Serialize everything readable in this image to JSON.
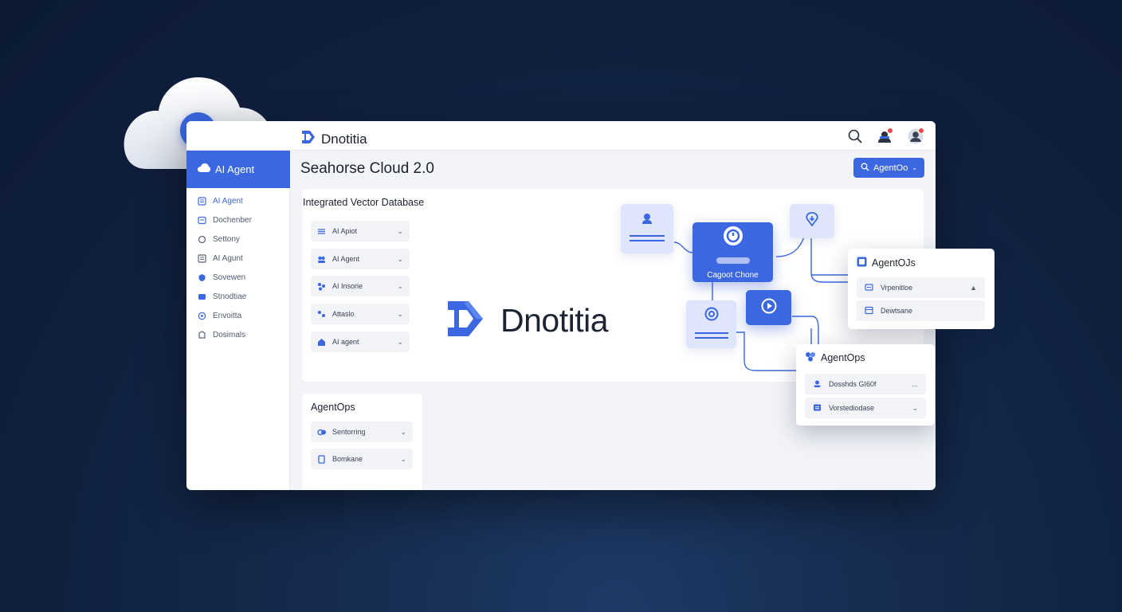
{
  "colors": {
    "accent": "#3b68e0",
    "background": "#0f1f3d",
    "badge": "#e5484d"
  },
  "header": {
    "brand": "Dnotitia",
    "icons": [
      "search-icon",
      "notifications-icon",
      "user-avatar-icon"
    ]
  },
  "sidebar": {
    "head_label": "AI Agent",
    "items": [
      {
        "label": "AI Agent",
        "icon": "agent-icon"
      },
      {
        "label": "Dochenber",
        "icon": "document-icon"
      },
      {
        "label": "Settony",
        "icon": "settings-icon"
      },
      {
        "label": "AI Agunt",
        "icon": "list-icon"
      },
      {
        "label": "Sovewen",
        "icon": "shield-icon"
      },
      {
        "label": "Stnodtiae",
        "icon": "structure-icon"
      },
      {
        "label": "Envoitta",
        "icon": "compass-icon"
      },
      {
        "label": "Dosimals",
        "icon": "database-icon"
      }
    ]
  },
  "main": {
    "title": "Seahorse Cloud 2.0",
    "agent_button": "AgentOo",
    "panel": {
      "title": "Integrated Vector Database",
      "dropdowns": [
        {
          "label": "AI Apiot"
        },
        {
          "label": "AI Agent"
        },
        {
          "label": "AI Insorie"
        },
        {
          "label": "Attaslo"
        },
        {
          "label": "AI agent"
        }
      ],
      "logo_text": "Dnotitia",
      "diagram": {
        "center_node_label": "Cagoot Chone"
      }
    },
    "agentops_panel": {
      "title": "AgentOps",
      "dropdowns": [
        {
          "label": "Sentorring"
        },
        {
          "label": "Bomkane"
        }
      ]
    }
  },
  "floating_cards": {
    "card1": {
      "title": "AgentOJs",
      "rows": [
        {
          "label": "Vrpenitloe"
        },
        {
          "label": "Dewtsane"
        }
      ]
    },
    "card2": {
      "title": "AgentOps",
      "rows": [
        {
          "label": "Dosshds GI60f",
          "trail": "..."
        },
        {
          "label": "Vorstediodase"
        }
      ]
    }
  }
}
